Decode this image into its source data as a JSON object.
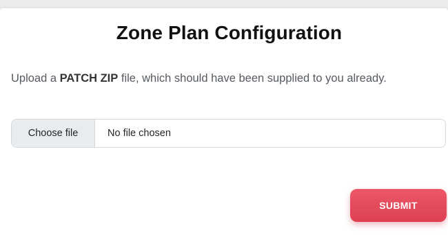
{
  "page": {
    "title": "Zone Plan Configuration",
    "description": {
      "prefix": "Upload a ",
      "emphasis": "PATCH ZIP",
      "suffix": " file, which should have been supplied to you already."
    }
  },
  "file_input": {
    "button_label": "Choose file",
    "status_text": "No file chosen"
  },
  "form": {
    "submit_label": "SUBMIT"
  },
  "colors": {
    "background": "#ececec",
    "card": "#ffffff",
    "submit_button": "#e44b5c",
    "file_button": "#e9ecef"
  }
}
